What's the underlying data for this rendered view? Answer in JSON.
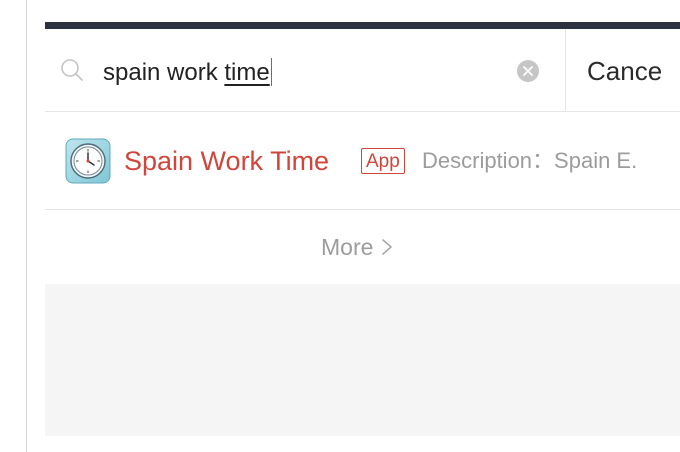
{
  "search": {
    "value_plain": "spain work ",
    "value_underlined": "time",
    "cancel_label": "Cance"
  },
  "result": {
    "title": "Spain Work Time",
    "badge": "App",
    "description": "Description：Spain E."
  },
  "more": {
    "label": "More"
  },
  "icons": {
    "search": "search-icon",
    "clear": "clear-icon",
    "app": "clock-app-icon",
    "chevron": "chevron-right-icon"
  },
  "colors": {
    "accent": "#d0463c",
    "top_bar": "#2d3240",
    "muted_text": "#9c9c9c",
    "empty_bg": "#f5f5f5"
  }
}
